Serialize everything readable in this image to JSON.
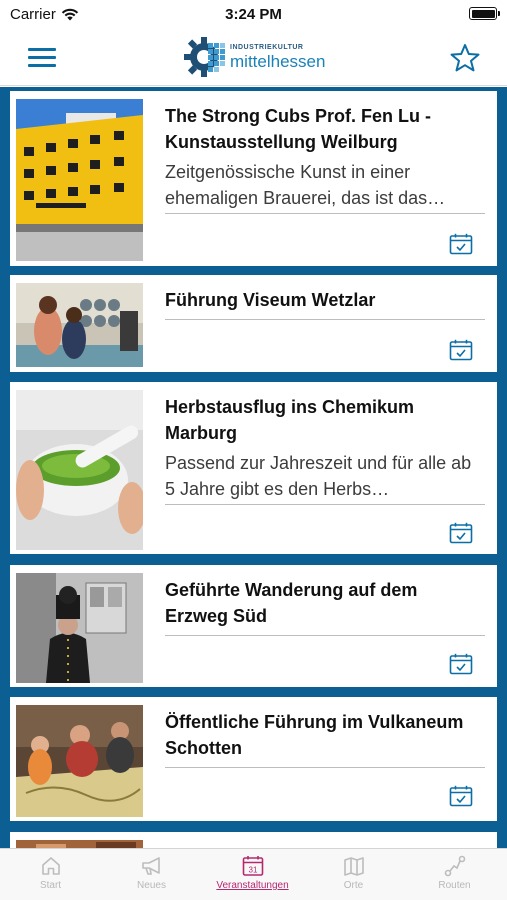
{
  "status_bar": {
    "carrier": "Carrier",
    "time": "3:24 PM"
  },
  "nav": {
    "logo_small": "INDUSTRIEKULTUR",
    "logo_big": "mittelhessen"
  },
  "events": [
    {
      "title": "The Strong Cubs Prof. Fen Lu - Kunstausstellung Weilburg",
      "description": "Zeitgenössische Kunst in einer ehemaligen Brauerei, das ist das…",
      "image": "building-photo"
    },
    {
      "title": "Führung Viseum Wetzlar",
      "description": "",
      "image": "museum-visitors-photo"
    },
    {
      "title": "Herbstausflug ins Chemikum Marburg",
      "description": "Passend zur Jahreszeit und für alle ab 5 Jahre gibt es den Herbs…",
      "image": "mortar-pestle-photo"
    },
    {
      "title": "Geführte Wanderung auf dem Erzweg Süd",
      "description": "",
      "image": "miner-guide-photo"
    },
    {
      "title": "Öffentliche Führung im Vulkaneum Schotten",
      "description": "",
      "image": "map-table-photo"
    }
  ],
  "tabs": [
    {
      "label": "Start",
      "icon": "home-icon"
    },
    {
      "label": "Neues",
      "icon": "megaphone-icon"
    },
    {
      "label": "Veranstaltungen",
      "icon": "calendar-icon"
    },
    {
      "label": "Orte",
      "icon": "map-icon"
    },
    {
      "label": "Routen",
      "icon": "route-icon"
    }
  ],
  "active_tab": "Veranstaltungen",
  "calendar_date": "31",
  "colors": {
    "brand_blue": "#0b5f93",
    "accent_blue": "#1a82b9",
    "active_tab": "#b5286e"
  }
}
